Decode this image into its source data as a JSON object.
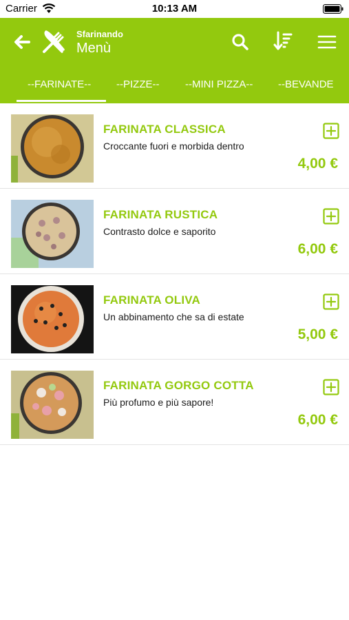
{
  "status_bar": {
    "carrier": "Carrier",
    "time": "10:13 AM"
  },
  "app_bar": {
    "subtitle": "Sfarinando",
    "title": "Menù",
    "icons": [
      "back-arrow-icon",
      "utensils-icon",
      "search-icon",
      "sort-icon",
      "hamburger-menu-icon"
    ]
  },
  "tabs": [
    {
      "label": "--FARINATE--",
      "selected": true
    },
    {
      "label": "--PIZZE--",
      "selected": false
    },
    {
      "label": "--MINI PIZZA--",
      "selected": false
    },
    {
      "label": "--BEVANDE",
      "selected": false
    }
  ],
  "items": [
    {
      "name": "FARINATA CLASSICA",
      "description": "Croccante fuori e morbida dentro",
      "price": "4,00 €"
    },
    {
      "name": "FARINATA RUSTICA",
      "description": "Contrasto dolce e saporito",
      "price": "6,00 €"
    },
    {
      "name": "FARINATA OLIVA",
      "description": "Un abbinamento che sa di estate",
      "price": "5,00 €"
    },
    {
      "name": "FARINATA GORGO COTTA",
      "description": "Più profumo e più sapore!",
      "price": "6,00 €"
    }
  ],
  "colors": {
    "accent": "#93c90e",
    "text": "#1a1a1a",
    "divider": "#e3e3e3"
  }
}
